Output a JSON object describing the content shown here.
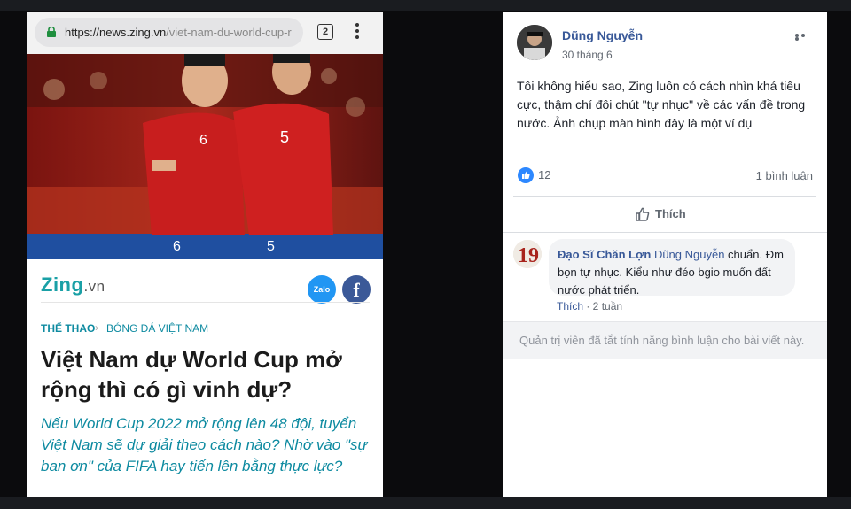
{
  "browser": {
    "url_host": "https://news.zing.vn",
    "url_path": "/viet-nam-du-world-cup-r",
    "tab_count": "2"
  },
  "article": {
    "logo_main": "Zing",
    "logo_suffix": ".vn",
    "share_zalo": "Zalo",
    "share_fb": "f",
    "category": "THỂ THAO",
    "category_sep": "›",
    "subcategory": "BÓNG ĐÁ VIỆT NAM",
    "headline": "Việt Nam dự World Cup mở rộng thì có gì vinh dự?",
    "sapo": "Nếu World Cup 2022 mở rộng lên 48 đội, tuyển Việt Nam sẽ dự giải theo cách nào? Nhờ vào \"sự ban ơn\" của FIFA hay tiến lên bằng thực lực?",
    "jersey_numbers": [
      "6",
      "5"
    ]
  },
  "post": {
    "author": "Dũng Nguyễn",
    "date": "30 tháng 6",
    "text": "Tôi không hiểu sao, Zing luôn có cách nhìn khá tiêu cực, thậm chí đôi chút \"tự nhục\" về các vấn đề trong nước. Ảnh chụp màn hình đây là một ví dụ",
    "like_count": "12",
    "comment_count": "1 bình luận",
    "like_button": "Thích",
    "comment": {
      "commenter": "Đạo Sĩ Chăn Lợn",
      "tag": "Dũng Nguyễn",
      "text": " chuẩn. Đm bọn tự nhục. Kiểu như đéo bgio muốn đất nước phát triển.",
      "action": "Thích",
      "time": " · 2 tuần",
      "avatar_number": "19"
    },
    "comments_disabled": "Quản trị viên đã tắt tính năng bình luận cho bài viết này."
  },
  "colors": {
    "fb_blue": "#385898",
    "zing_teal": "#0d8aa0",
    "like_blue": "#2d88ff"
  }
}
